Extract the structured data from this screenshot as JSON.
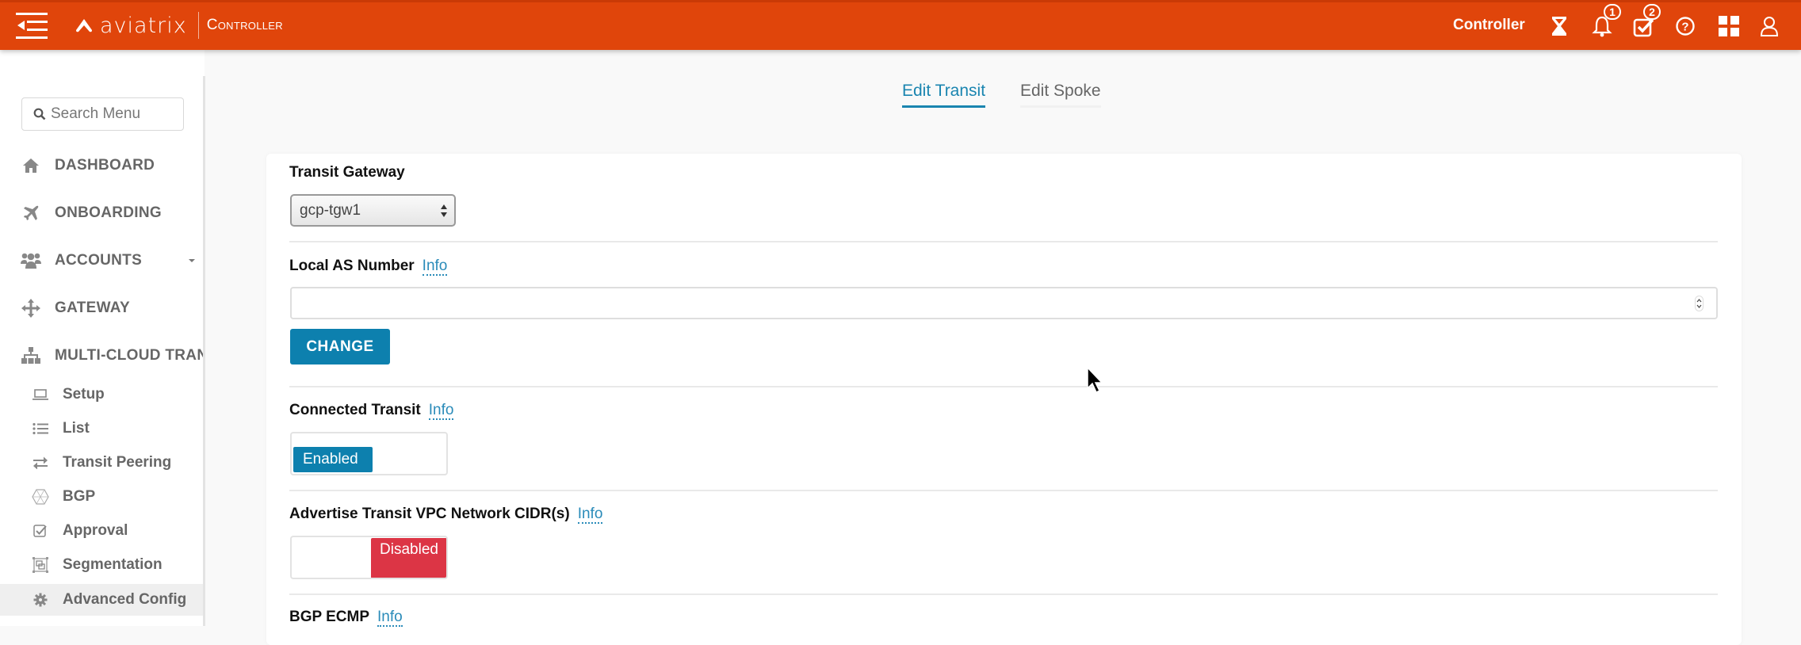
{
  "header": {
    "brand": "aviatrix",
    "product": "Controller",
    "controller_label": "Controller",
    "icons": [
      "menu-toggle-icon",
      "hourglass-icon",
      "bell-icon",
      "tasks-check-icon",
      "help-icon",
      "apps-grid-icon",
      "user-icon"
    ],
    "notifications_count": "1",
    "tasks_count": "2",
    "accent_color": "#e0450b"
  },
  "sidebar": {
    "search_placeholder": "Search Menu",
    "items": [
      {
        "label": "DASHBOARD",
        "icon": "home-icon"
      },
      {
        "label": "ONBOARDING",
        "icon": "plane-icon"
      },
      {
        "label": "ACCOUNTS",
        "icon": "users-icon",
        "has_caret": true
      },
      {
        "label": "GATEWAY",
        "icon": "move-arrows-icon"
      },
      {
        "label": "MULTI-CLOUD TRAN",
        "icon": "sitemap-icon"
      }
    ],
    "sub_items": [
      {
        "label": "Setup",
        "icon": "laptop-icon"
      },
      {
        "label": "List",
        "icon": "list-icon"
      },
      {
        "label": "Transit Peering",
        "icon": "exchange-icon"
      },
      {
        "label": "BGP",
        "icon": "bgp-hexagon-icon"
      },
      {
        "label": "Approval",
        "icon": "check-square-icon"
      },
      {
        "label": "Segmentation",
        "icon": "segmentation-icon"
      },
      {
        "label": "Advanced Config",
        "icon": "gear-icon",
        "active": true
      }
    ]
  },
  "tabs": [
    {
      "label": "Edit Transit",
      "active": true
    },
    {
      "label": "Edit Spoke",
      "active": false
    }
  ],
  "form": {
    "transit_gateway": {
      "label": "Transit Gateway",
      "selected": "gcp-tgw1"
    },
    "local_as": {
      "label": "Local AS Number",
      "info": "Info",
      "value": "",
      "button": "CHANGE"
    },
    "connected_transit": {
      "label": "Connected Transit",
      "info": "Info",
      "state": "Enabled"
    },
    "advertise_cidr": {
      "label": "Advertise Transit VPC Network CIDR(s)",
      "info": "Info",
      "state": "Disabled"
    },
    "bgp_ecmp": {
      "label": "BGP ECMP",
      "info": "Info"
    }
  },
  "colors": {
    "primary_blue": "#0d80ae",
    "link_blue": "#2a8bb9",
    "disabled_red": "#dc3545"
  }
}
